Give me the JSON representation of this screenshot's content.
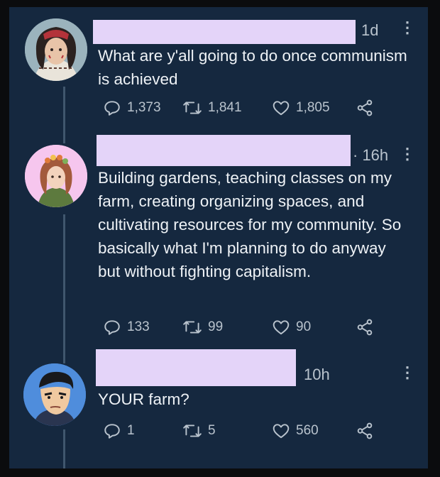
{
  "tweets": [
    {
      "time": "1d",
      "text": "What are y'all going to do once communism is achieved",
      "replies": "1,373",
      "retweets": "1,841",
      "likes": "1,805"
    },
    {
      "time": "· 16h",
      "text": "Building gardens, teaching classes on my farm,  creating organizing spaces, and cultivating resources for my community. So basically what I'm planning to do anyway but without fighting capitalism.",
      "replies": "133",
      "retweets": "99",
      "likes": "90"
    },
    {
      "time": "10h",
      "text": "YOUR farm?",
      "replies": "1",
      "retweets": "5",
      "likes": "560"
    }
  ],
  "colors": {
    "background": "#15283f",
    "name_redaction": "#e4d4f9",
    "text": "#eef2f6",
    "muted": "#b9c3cd",
    "thread_line": "#40576e"
  },
  "icons": [
    "reply-icon",
    "retweet-icon",
    "like-icon",
    "share-icon",
    "more-options-icon"
  ]
}
